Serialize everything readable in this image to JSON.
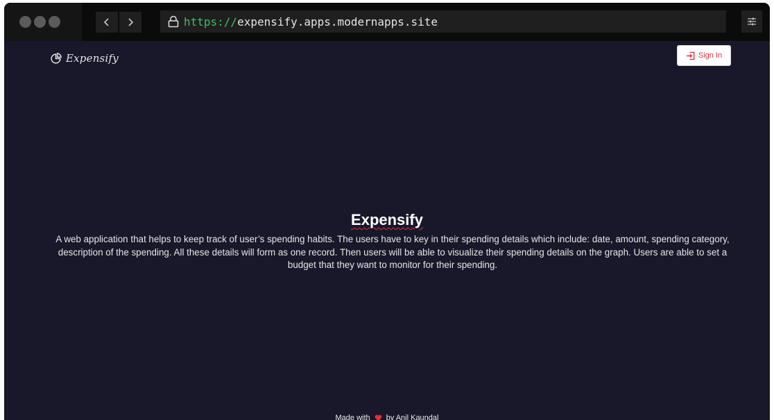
{
  "browser": {
    "url_scheme": "https://",
    "url_host": "expensify.apps.modernapps.site",
    "icons": {
      "back": "chevron-left-icon",
      "forward": "chevron-right-icon",
      "lock": "lock-icon",
      "settings": "sliders-icon"
    }
  },
  "header": {
    "logo_text": "Expensify",
    "logo_icon": "pie-chart-icon",
    "signin_label": "Sign In",
    "signin_icon": "sign-in-icon"
  },
  "hero": {
    "title": "Expensify",
    "description": "A web application that helps to keep track of user’s spending habits. The users have to key in their spending details which include: date, amount, spending category, description of the spending. All these details will form as one record. Then users will be able to visualize their spending details on the graph. Users are able to set a budget that they want to monitor for their spending."
  },
  "footer": {
    "made_with": "Made with",
    "heart_icon": "heart-icon",
    "by_author": "by Anil Kaundal"
  },
  "colors": {
    "page_background": "#18182a",
    "accent_red": "#e0303a",
    "url_scheme_green": "#3fbf62"
  }
}
